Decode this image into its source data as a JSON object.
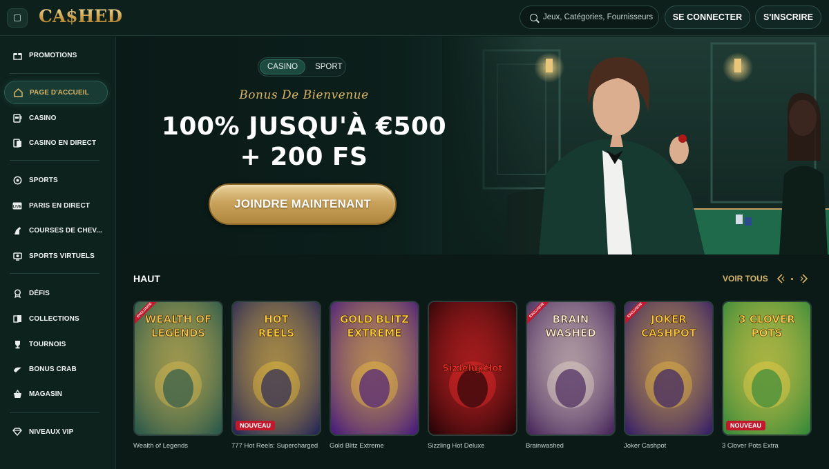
{
  "header": {
    "logo": "CA$HED",
    "search_placeholder": "Jeux, Catégories, Fournisseurs",
    "login_label": "SE CONNECTER",
    "register_label": "S'INSCRIRE"
  },
  "sidebar": {
    "items": [
      {
        "label": "PROMOTIONS",
        "icon": "gift-icon"
      },
      {
        "label": "PAGE D'ACCUEIL",
        "icon": "home-icon",
        "active": true
      },
      {
        "label": "CASINO",
        "icon": "slot-machine-icon"
      },
      {
        "label": "CASINO EN DIRECT",
        "icon": "live-cards-icon"
      },
      {
        "label": "SPORTS",
        "icon": "ball-icon"
      },
      {
        "label": "PARIS EN DIRECT",
        "icon": "live-badge-icon"
      },
      {
        "label": "COURSES DE CHEV...",
        "icon": "horse-icon"
      },
      {
        "label": "SPORTS VIRTUELS",
        "icon": "virtual-screen-icon"
      },
      {
        "label": "DÉFIS",
        "icon": "challenge-icon"
      },
      {
        "label": "COLLECTIONS",
        "icon": "collections-icon"
      },
      {
        "label": "TOURNOIS",
        "icon": "trophy-icon"
      },
      {
        "label": "BONUS CRAB",
        "icon": "crab-icon"
      },
      {
        "label": "MAGASIN",
        "icon": "basket-icon"
      },
      {
        "label": "NIVEAUX VIP",
        "icon": "diamond-icon"
      }
    ]
  },
  "hero": {
    "toggle": [
      "CASINO",
      "SPORT"
    ],
    "bonus_script": "Bonus De Bienvenue",
    "line1": "100% JUSQU'À €500",
    "line2": "+ 200 FS",
    "cta": "JOINDRE MAINTENANT"
  },
  "section": {
    "title": "HAUT",
    "see_all": "VOIR TOUS"
  },
  "games": [
    {
      "name": "Wealth of Legends",
      "title_art": "WEALTH OF LEGENDS",
      "ribbon": "EXCLUSIVE",
      "bg": "#2d5a4a",
      "accent": "#f0c552"
    },
    {
      "name": "777 Hot Reels: Supercharged",
      "title_art": "HOT REELS",
      "badge": "NOUVEAU",
      "bg": "#2b2a57",
      "accent": "#ffcf3a"
    },
    {
      "name": "Gold Blitz Extreme",
      "title_art": "GOLD BLITZ EXTREME",
      "bg": "#4b1f7a",
      "accent": "#ffd23a"
    },
    {
      "name": "Sizzling Hot Deluxe",
      "title_art": "Sizzling Hot deluxe",
      "bg": "#2a0508",
      "accent": "#ff2d2d"
    },
    {
      "name": "Brainwashed",
      "title_art": "BRAIN WASHED",
      "ribbon": "EXCLUSIVE",
      "bg": "#4b2a5e",
      "accent": "#f7ecd4"
    },
    {
      "name": "Joker Cashpot",
      "title_art": "JOKER CASHPOT",
      "ribbon": "EXCLUSIVE",
      "bg": "#3a2366",
      "accent": "#f6c640"
    },
    {
      "name": "3 Clover Pots Extra",
      "title_art": "3 CLOVER POTS",
      "badge": "NOUVEAU",
      "bg": "#3a8a3a",
      "accent": "#ffd34a"
    }
  ],
  "colors": {
    "background": "#0b1a17",
    "gold": "#d9b56a",
    "sidebar_active": "#183b33"
  }
}
